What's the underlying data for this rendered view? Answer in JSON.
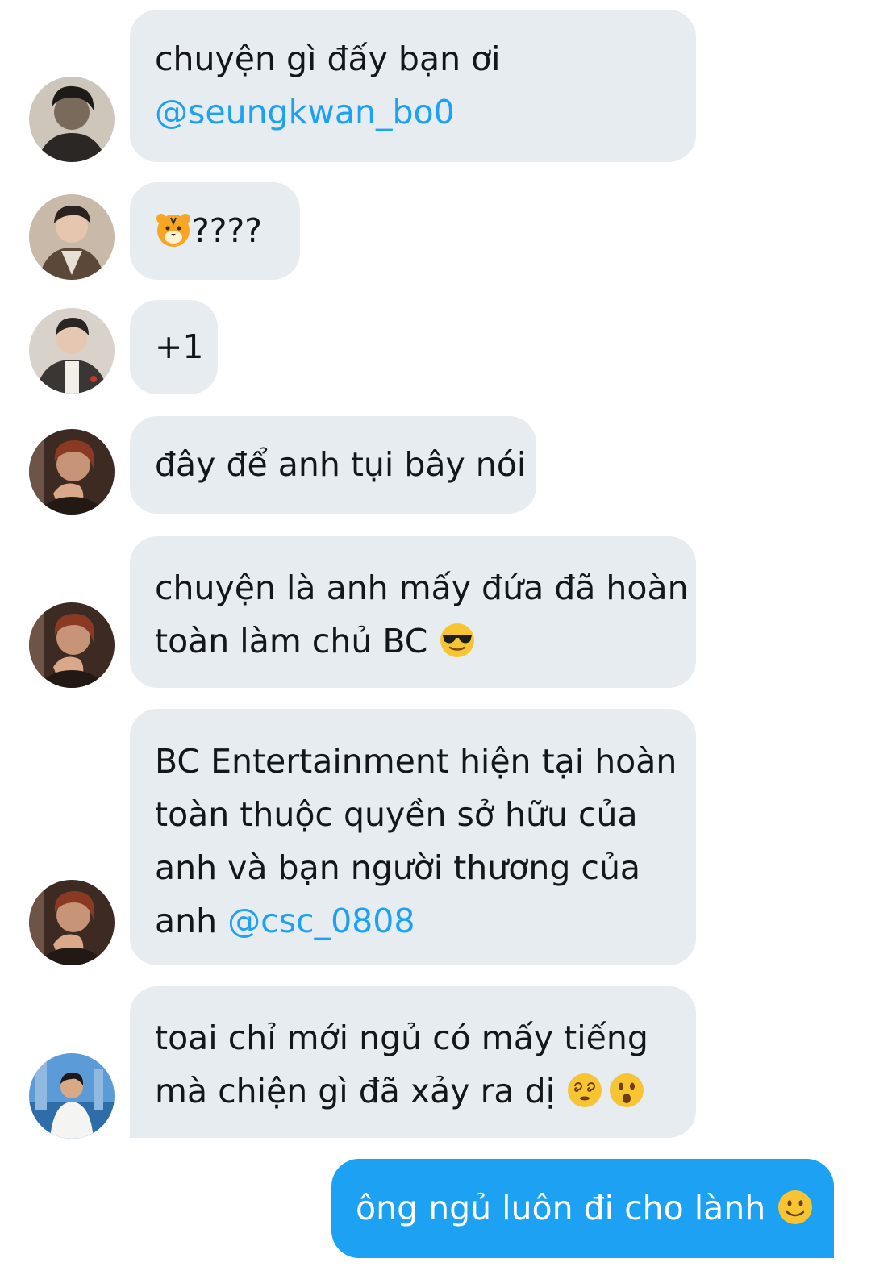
{
  "messages": [
    {
      "line1": "chuyện gì đấy bạn ơi",
      "mention": "@seungkwan_bo0"
    },
    {
      "emoji": "tiger-face-icon",
      "text": "????"
    },
    {
      "text": "+1"
    },
    {
      "text": "đây để anh tụi bây nói"
    },
    {
      "line1": "chuyện là anh mấy đứa đã hoàn",
      "line2": "toàn làm chủ BC",
      "emoji": "sunglasses-face-icon"
    },
    {
      "line1": "BC Entertainment hiện tại hoàn",
      "line2": "toàn thuộc quyền sở hữu của",
      "line3": "anh và bạn người thương của",
      "line4_prefix": "anh",
      "mention": "@csc_0808"
    },
    {
      "line1": "toai chỉ mới ngủ có mấy tiếng",
      "line2": "mà chiện gì đã xảy ra dị",
      "emojis": [
        "dizzy-face-icon",
        "astonished-face-icon"
      ]
    }
  ],
  "outgoing": {
    "text": "ông ngủ luôn đi cho lành",
    "emoji": "slightly-smiling-face-icon"
  },
  "colors": {
    "incoming_bubble": "#e6ecf0",
    "outgoing_bubble": "#1da1f2",
    "mention": "#1da1f2",
    "text": "#14171a"
  }
}
